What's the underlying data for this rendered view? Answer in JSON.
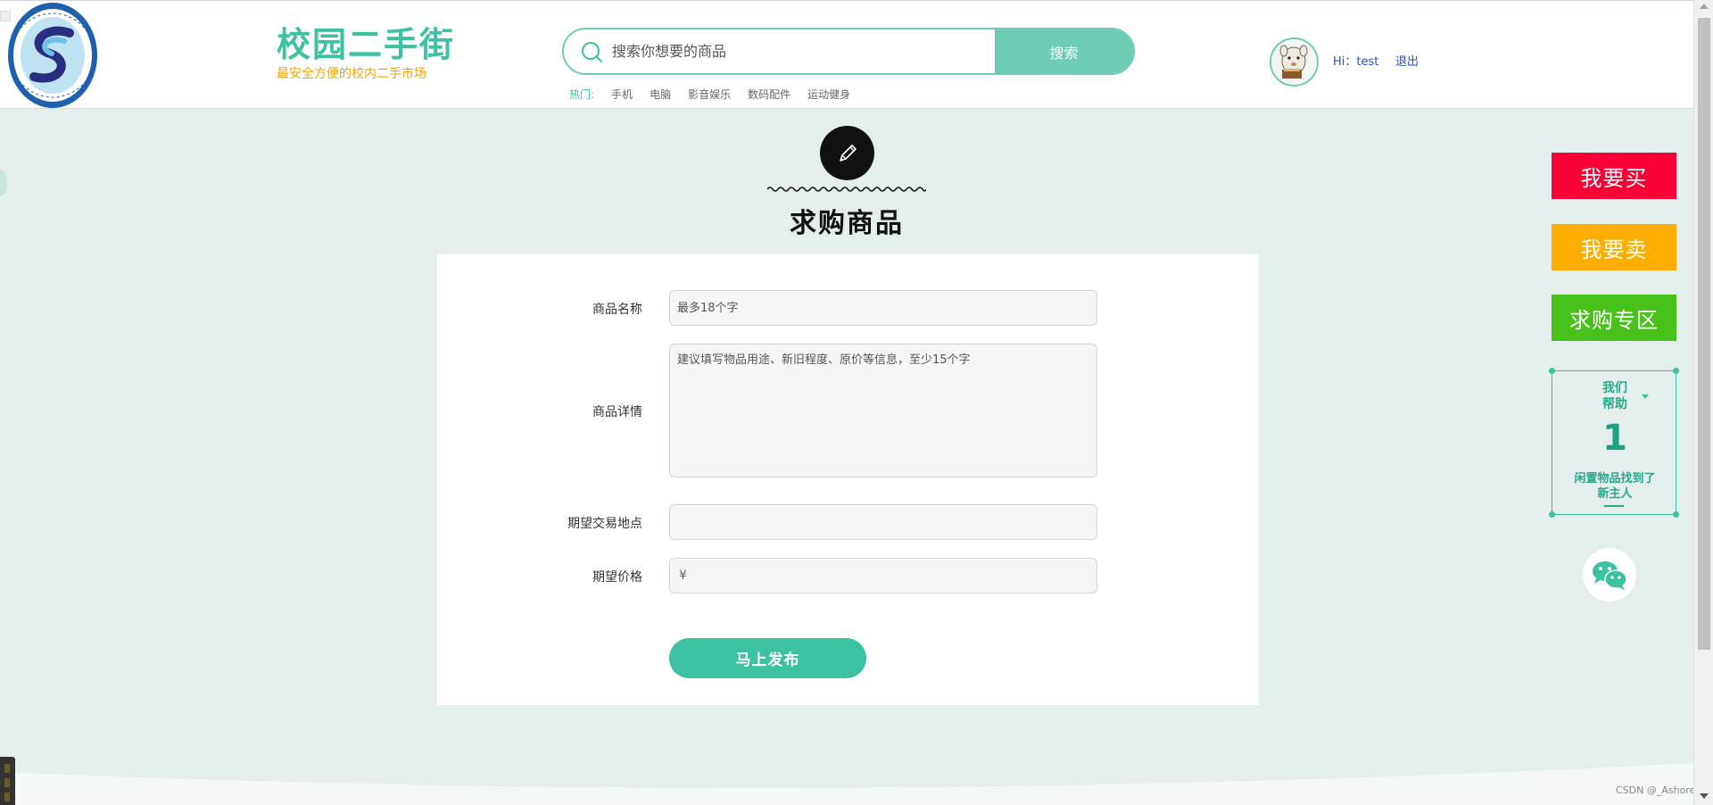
{
  "header": {
    "brand_title": "校园二手街",
    "brand_subtitle": "最安全方便的校内二手市场",
    "search": {
      "placeholder": "搜索你想要的商品",
      "button_label": "搜索"
    },
    "hot": {
      "label": "热门:",
      "links": [
        "手机",
        "电脑",
        "影音娱乐",
        "数码配件",
        "运动健身"
      ]
    },
    "user": {
      "greeting": "Hi：test",
      "logout_label": "退出"
    }
  },
  "page": {
    "title": "求购商品"
  },
  "form": {
    "name": {
      "label": "商品名称",
      "placeholder": "最多18个字"
    },
    "detail": {
      "label": "商品详情",
      "placeholder": "建议填写物品用途、新旧程度、原价等信息，至少15个字"
    },
    "location": {
      "label": "期望交易地点",
      "placeholder": ""
    },
    "price": {
      "label": "期望价格",
      "currency": "¥"
    },
    "submit_label": "马上发布"
  },
  "sidebar": {
    "buy_label": "我要买",
    "sell_label": "我要卖",
    "want_label": "求购专区",
    "help": {
      "title_line1": "我们",
      "title_line2": "帮助",
      "count": "1",
      "desc_line1": "闲置物品找到了",
      "desc_line2": "新主人"
    }
  },
  "watermark": "CSDN @_Ashore",
  "colors": {
    "accent": "#3cc1a1",
    "buy": "#fb0036",
    "sell": "#fdae00",
    "want": "#48c11a",
    "page_bg": "#e4eeec"
  },
  "icons": [
    "school-logo",
    "search-icon",
    "avatar",
    "pencil-icon",
    "wechat-icon"
  ]
}
